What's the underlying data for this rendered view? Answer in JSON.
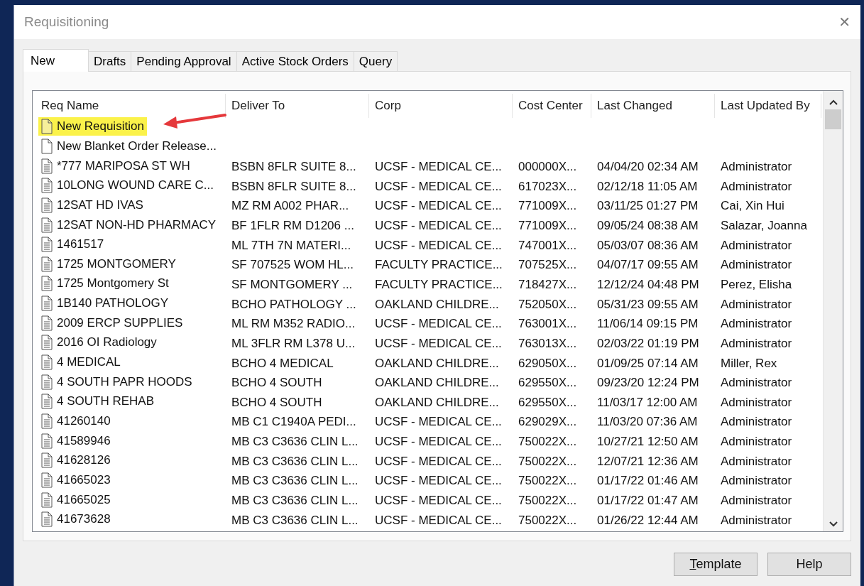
{
  "window": {
    "title": "Requisitioning",
    "close": "✕"
  },
  "tabs": [
    {
      "label": "New",
      "selected": true
    },
    {
      "label": "Drafts",
      "selected": false
    },
    {
      "label": "Pending Approval",
      "selected": false
    },
    {
      "label": "Active Stock Orders",
      "selected": false
    },
    {
      "label": "Query",
      "selected": false
    }
  ],
  "table": {
    "columns": [
      "Req Name",
      "Deliver To",
      "Corp",
      "Cost Center",
      "Last Changed",
      "Last Updated By"
    ],
    "rows": [
      {
        "kind": "blank",
        "highlighted": true,
        "cells": [
          "New Requisition"
        ]
      },
      {
        "kind": "blank",
        "highlighted": false,
        "cells": [
          "New Blanket Order Release..."
        ]
      },
      {
        "kind": "document",
        "highlighted": false,
        "cells": [
          "*777 MARIPOSA ST WH",
          "BSBN 8FLR SUITE 8...",
          "UCSF - MEDICAL CE...",
          "000000X...",
          "04/04/20 02:34 AM",
          "Administrator"
        ]
      },
      {
        "kind": "document",
        "highlighted": false,
        "cells": [
          "10LONG WOUND CARE C...",
          "BSBN 8FLR SUITE 8...",
          "UCSF - MEDICAL CE...",
          "617023X...",
          "02/12/18 11:05 AM",
          "Administrator"
        ]
      },
      {
        "kind": "document",
        "highlighted": false,
        "cells": [
          "12SAT HD IVAS",
          "MZ RM A002 PHAR...",
          "UCSF - MEDICAL CE...",
          "771009X...",
          "03/11/25 01:27 PM",
          "Cai, Xin Hui"
        ]
      },
      {
        "kind": "document",
        "highlighted": false,
        "cells": [
          "12SAT NON-HD PHARMACY",
          "BF 1FLR RM D1206 ...",
          "UCSF - MEDICAL CE...",
          "771009X...",
          "09/05/24 08:38 AM",
          "Salazar, Joanna"
        ]
      },
      {
        "kind": "document",
        "highlighted": false,
        "cells": [
          "1461517",
          "ML 7TH 7N MATERI...",
          "UCSF - MEDICAL CE...",
          "747001X...",
          "05/03/07 08:36 AM",
          "Administrator"
        ]
      },
      {
        "kind": "document",
        "highlighted": false,
        "cells": [
          "1725 MONTGOMERY",
          "SF 707525 WOM HL...",
          "FACULTY PRACTICE...",
          "707525X...",
          "04/07/17 09:55 AM",
          "Administrator"
        ]
      },
      {
        "kind": "document",
        "highlighted": false,
        "cells": [
          "1725 Montgomery St",
          "SF MONTGOMERY ...",
          "FACULTY PRACTICE...",
          "718427X...",
          "12/12/24 04:48 PM",
          "Perez, Elisha"
        ]
      },
      {
        "kind": "document",
        "highlighted": false,
        "cells": [
          "1B140 PATHOLOGY",
          "BCHO PATHOLOGY ...",
          "OAKLAND CHILDRE...",
          "752050X...",
          "05/31/23 09:55 AM",
          "Administrator"
        ]
      },
      {
        "kind": "document",
        "highlighted": false,
        "cells": [
          "2009 ERCP SUPPLIES",
          "ML RM M352 RADIO...",
          "UCSF - MEDICAL CE...",
          "763001X...",
          "11/06/14 09:15 PM",
          "Administrator"
        ]
      },
      {
        "kind": "document",
        "highlighted": false,
        "cells": [
          "2016 OI Radiology",
          "ML 3FLR RM L378 U...",
          "UCSF - MEDICAL CE...",
          "763013X...",
          "02/03/22 01:19 PM",
          "Administrator"
        ]
      },
      {
        "kind": "document",
        "highlighted": false,
        "cells": [
          "4 MEDICAL",
          "BCHO 4 MEDICAL",
          "OAKLAND CHILDRE...",
          "629050X...",
          "01/09/25 07:14 AM",
          "Miller, Rex"
        ]
      },
      {
        "kind": "document",
        "highlighted": false,
        "cells": [
          "4 SOUTH PAPR HOODS",
          "BCHO 4 SOUTH",
          "OAKLAND CHILDRE...",
          "629550X...",
          "09/23/20 12:24 PM",
          "Administrator"
        ]
      },
      {
        "kind": "document",
        "highlighted": false,
        "cells": [
          "4 SOUTH REHAB",
          "BCHO 4 SOUTH",
          "OAKLAND CHILDRE...",
          "629550X...",
          "11/03/17 12:00 AM",
          "Administrator"
        ]
      },
      {
        "kind": "document",
        "highlighted": false,
        "cells": [
          "41260140",
          "MB C1 C1940A PEDI...",
          "UCSF - MEDICAL CE...",
          "629029X...",
          "11/03/20 07:36 AM",
          "Administrator"
        ]
      },
      {
        "kind": "document",
        "highlighted": false,
        "cells": [
          "41589946",
          "MB C3 C3636 CLIN L...",
          "UCSF - MEDICAL CE...",
          "750022X...",
          "10/27/21 12:50 AM",
          "Administrator"
        ]
      },
      {
        "kind": "document",
        "highlighted": false,
        "cells": [
          "41628126",
          "MB C3 C3636 CLIN L...",
          "UCSF - MEDICAL CE...",
          "750022X...",
          "12/07/21 12:36 AM",
          "Administrator"
        ]
      },
      {
        "kind": "document",
        "highlighted": false,
        "cells": [
          "41665023",
          "MB C3 C3636 CLIN L...",
          "UCSF - MEDICAL CE...",
          "750022X...",
          "01/17/22 01:46 AM",
          "Administrator"
        ]
      },
      {
        "kind": "document",
        "highlighted": false,
        "cells": [
          "41665025",
          "MB C3 C3636 CLIN L...",
          "UCSF - MEDICAL CE...",
          "750022X...",
          "01/17/22 01:47 AM",
          "Administrator"
        ]
      },
      {
        "kind": "document",
        "highlighted": false,
        "cells": [
          "41673628",
          "MB C3 C3636 CLIN L...",
          "UCSF - MEDICAL CE...",
          "750022X...",
          "01/26/22 12:44 AM",
          "Administrator"
        ]
      }
    ]
  },
  "buttons": [
    {
      "label": "Template",
      "mnemonic_underlined": true
    },
    {
      "label": "Help",
      "mnemonic_underlined": false
    }
  ]
}
